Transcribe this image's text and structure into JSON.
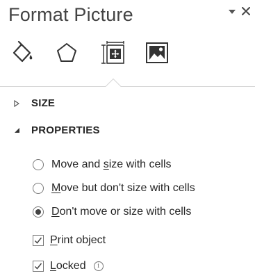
{
  "pane": {
    "title": "Format Picture",
    "menu_icon": "chevron-down-icon",
    "close_glyph": "✕"
  },
  "tabs": [
    {
      "id": "fill-line",
      "icon": "paint-bucket-icon",
      "selected": false
    },
    {
      "id": "effects",
      "icon": "pentagon-icon",
      "selected": false
    },
    {
      "id": "size-properties",
      "icon": "size-properties-icon",
      "selected": true
    },
    {
      "id": "picture",
      "icon": "picture-icon",
      "selected": false
    }
  ],
  "sections": {
    "size": {
      "label": "SIZE",
      "expanded": false
    },
    "properties": {
      "label": "PROPERTIES",
      "expanded": true
    }
  },
  "properties": {
    "options": [
      {
        "before": "Move and ",
        "underline": "s",
        "after": "ize with cells",
        "selected": false
      },
      {
        "before": "",
        "underline": "M",
        "after": "ove but don't size with cells",
        "selected": false
      },
      {
        "before": "",
        "underline": "D",
        "after": "on't move or size with cells",
        "selected": true
      }
    ],
    "print_object": {
      "before": "",
      "underline": "P",
      "after": "rint object",
      "checked": true
    },
    "locked": {
      "before": "",
      "underline": "L",
      "after": "ocked",
      "checked": true,
      "info_glyph": "i"
    }
  }
}
